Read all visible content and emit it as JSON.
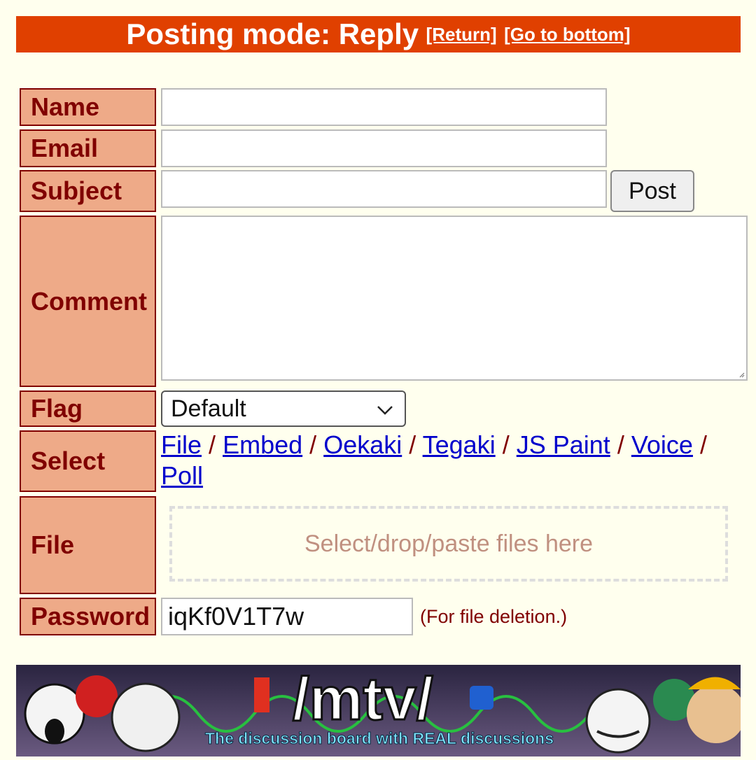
{
  "header": {
    "title": "Posting mode: Reply",
    "return_link": "[Return]",
    "bottom_link": "[Go to bottom]"
  },
  "form": {
    "labels": {
      "name": "Name",
      "email": "Email",
      "subject": "Subject",
      "comment": "Comment",
      "flag": "Flag",
      "select": "Select",
      "file": "File",
      "password": "Password"
    },
    "post_button": "Post",
    "flag_value": "Default",
    "select_modes": [
      "File",
      "Embed",
      "Oekaki",
      "Tegaki",
      "JS Paint",
      "Voice",
      "Poll"
    ],
    "separator": "/",
    "dropzone_text": "Select/drop/paste files here",
    "password_value": "iqKf0V1T7w",
    "password_note": "(For file deletion.)"
  },
  "banner": {
    "title": "/mtv/",
    "tagline": "The discussion board with REAL discussions"
  },
  "colors": {
    "mode_bar": "#e04000",
    "label_bg": "#eeaa88",
    "label_text": "#800000",
    "page_bg": "#ffffee",
    "link": "#0000cc"
  }
}
